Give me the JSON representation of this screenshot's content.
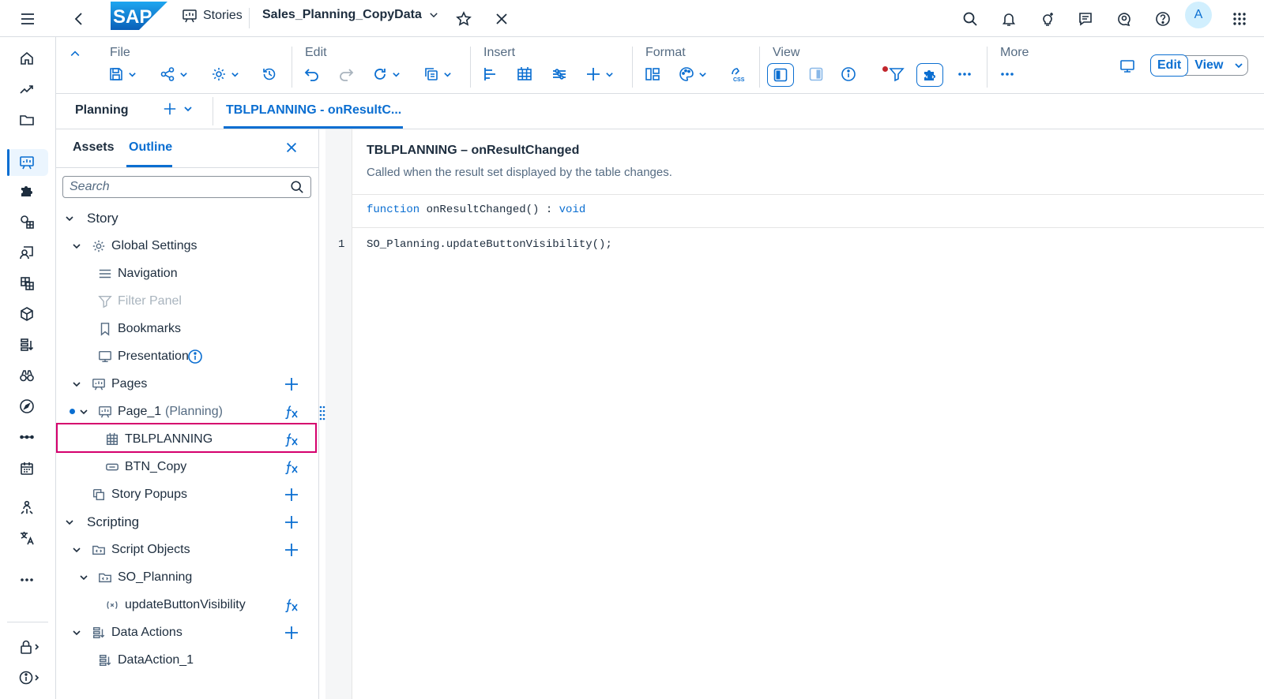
{
  "shellbar": {
    "logo_text": "SAP",
    "stories_label": "Stories",
    "story_title": "Sales_Planning_CopyData",
    "avatar_initial": "A"
  },
  "toolbar": {
    "groups": {
      "file": "File",
      "edit": "Edit",
      "insert": "Insert",
      "format": "Format",
      "view": "View",
      "more": "More"
    },
    "edit_label": "Edit",
    "view_label": "View"
  },
  "tabs": {
    "planning": "Planning",
    "script": "TBLPLANNING - onResultC..."
  },
  "outline": {
    "tab_assets": "Assets",
    "tab_outline": "Outline",
    "search_placeholder": "Search",
    "tree": {
      "story": "Story",
      "global_settings": "Global Settings",
      "navigation": "Navigation",
      "filter_panel": "Filter Panel",
      "bookmarks": "Bookmarks",
      "presentation": "Presentation",
      "pages": "Pages",
      "page_1": "Page_1",
      "page_1_suffix": "(Planning)",
      "tblplanning": "TBLPLANNING",
      "btn_copy": "BTN_Copy",
      "story_popups": "Story Popups",
      "scripting": "Scripting",
      "script_objects": "Script Objects",
      "so_planning": "SO_Planning",
      "update_button_visibility": "updateButtonVisibility",
      "data_actions": "Data Actions",
      "data_action_1": "DataAction_1"
    }
  },
  "editor": {
    "title": "TBLPLANNING – onResultChanged",
    "description": "Called when the result set displayed by the table changes.",
    "sig_keyword": "function",
    "sig_name": " onResultChanged() : ",
    "sig_return": "void",
    "line_number": "1",
    "code": "SO_Planning.updateButtonVisibility();"
  },
  "colors": {
    "accent": "#0a6ed1",
    "highlight": "#d5006d",
    "text": "#1d2d3e",
    "muted": "#556b82"
  }
}
